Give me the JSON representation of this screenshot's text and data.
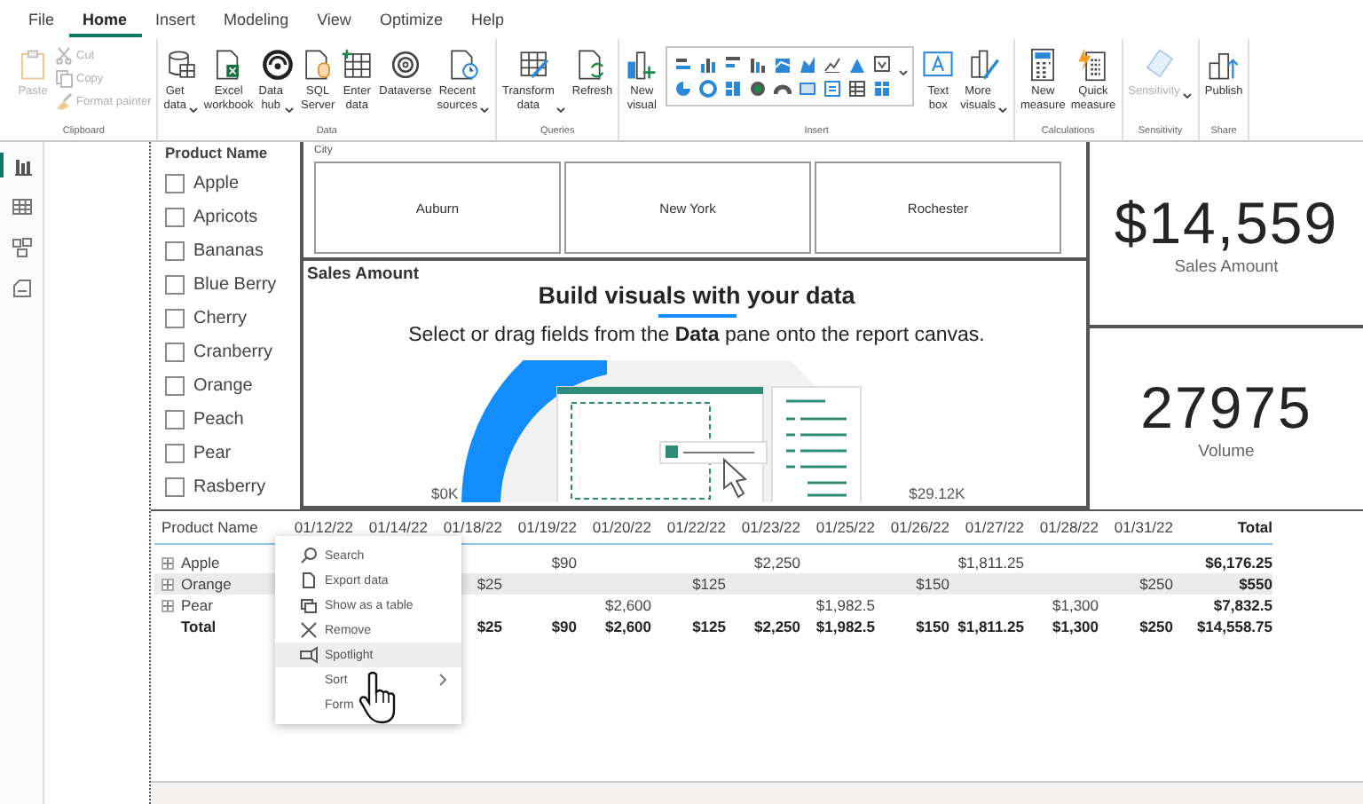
{
  "ribbon": {
    "tabs": [
      {
        "label": "File",
        "selected": false
      },
      {
        "label": "Home",
        "selected": true
      },
      {
        "label": "Insert",
        "selected": false
      },
      {
        "label": "Modeling",
        "selected": false
      },
      {
        "label": "View",
        "selected": false
      },
      {
        "label": "Optimize",
        "selected": false
      },
      {
        "label": "Help",
        "selected": false
      }
    ],
    "groups": [
      {
        "label": "Clipboard",
        "buttons": [
          {
            "kind": "large",
            "label": "Paste",
            "disabled": true,
            "dropdown": false
          },
          {
            "kind": "small",
            "label": "Cut",
            "disabled": true,
            "dropdown": false
          },
          {
            "kind": "small",
            "label": "Copy",
            "disabled": true,
            "dropdown": false
          },
          {
            "kind": "small",
            "label": "Format painter",
            "disabled": true,
            "dropdown": false
          }
        ]
      },
      {
        "label": "Data",
        "buttons": [
          {
            "kind": "large",
            "label": "Get data",
            "disabled": false,
            "dropdown": true
          },
          {
            "kind": "large",
            "label": "Excel workbook",
            "disabled": false,
            "dropdown": false
          },
          {
            "kind": "large",
            "label": "Data hub",
            "disabled": false,
            "dropdown": true
          },
          {
            "kind": "large",
            "label": "SQL Server",
            "disabled": false,
            "dropdown": false
          },
          {
            "kind": "large",
            "label": "Enter data",
            "disabled": false,
            "dropdown": false
          },
          {
            "kind": "large",
            "label": "Dataverse",
            "disabled": false,
            "dropdown": false
          },
          {
            "kind": "large",
            "label": "Recent sources",
            "disabled": false,
            "dropdown": true
          }
        ]
      },
      {
        "label": "Queries",
        "buttons": [
          {
            "kind": "large",
            "label": "Transform data",
            "disabled": false,
            "dropdown": true
          },
          {
            "kind": "large",
            "label": "Refresh",
            "disabled": false,
            "dropdown": false
          }
        ]
      },
      {
        "label": "Insert",
        "buttons": [
          {
            "kind": "large",
            "label": "New visual",
            "disabled": false,
            "dropdown": false
          },
          {
            "kind": "gallery"
          },
          {
            "kind": "large",
            "label": "Text box",
            "disabled": false,
            "dropdown": false
          },
          {
            "kind": "large",
            "label": "More visuals",
            "disabled": false,
            "dropdown": true
          }
        ]
      },
      {
        "label": "Calculations",
        "buttons": [
          {
            "kind": "large",
            "label": "New measure",
            "disabled": false,
            "dropdown": false
          },
          {
            "kind": "large",
            "label": "Quick measure",
            "disabled": false,
            "dropdown": false
          }
        ]
      },
      {
        "label": "Sensitivity",
        "buttons": [
          {
            "kind": "large",
            "label": "Sensitivity",
            "disabled": true,
            "dropdown": true
          }
        ]
      },
      {
        "label": "Share",
        "buttons": [
          {
            "kind": "large",
            "label": "Publish",
            "disabled": false,
            "dropdown": false
          }
        ]
      }
    ]
  },
  "nav": [
    {
      "selected": true
    },
    {
      "selected": false
    },
    {
      "selected": false
    },
    {
      "selected": false
    }
  ],
  "slicer": {
    "title": "Product Name",
    "items": [
      {
        "label": "Apple",
        "checked": false
      },
      {
        "label": "Apricots",
        "checked": false
      },
      {
        "label": "Bananas",
        "checked": false
      },
      {
        "label": "Blue Berry",
        "checked": false
      },
      {
        "label": "Cherry",
        "checked": false
      },
      {
        "label": "Cranberry",
        "checked": false
      },
      {
        "label": "Orange",
        "checked": false
      },
      {
        "label": "Peach",
        "checked": false
      },
      {
        "label": "Pear",
        "checked": false
      },
      {
        "label": "Rasberry",
        "checked": false
      }
    ]
  },
  "city_slicer": {
    "title": "City",
    "tiles": [
      {
        "label": "Auburn",
        "selected": false
      },
      {
        "label": "New York",
        "selected": false
      },
      {
        "label": "Rochester",
        "selected": false
      }
    ]
  },
  "sales_visual": {
    "title": "Sales Amount",
    "heading": "Build visuals with your data",
    "message": "Select or drag fields from the **Data** pane onto the report canvas.",
    "axis_min": "$0K",
    "axis_max": "$29.12K"
  },
  "cards": [
    {
      "value": "$14,559",
      "label": "Sales Amount"
    },
    {
      "value": "27975",
      "label": "Volume"
    }
  ],
  "matrix": {
    "columns": [
      "Product Name",
      "01/12/22",
      "01/14/22",
      "01/18/22",
      "01/19/22",
      "01/20/22",
      "01/22/22",
      "01/23/22",
      "01/25/22",
      "01/26/22",
      "01/27/22",
      "01/28/22",
      "01/31/22",
      "Total"
    ],
    "rows": [
      {
        "kind": "item",
        "expanded": false,
        "highlighted": false,
        "cells": [
          "Apple",
          null,
          null,
          null,
          "$90",
          null,
          null,
          "$2,250",
          null,
          null,
          "$1,811.25",
          null,
          null,
          "$6,176.25"
        ]
      },
      {
        "kind": "item",
        "expanded": false,
        "highlighted": true,
        "cells": [
          "Orange",
          null,
          null,
          "$25",
          null,
          null,
          "$125",
          null,
          null,
          "$150",
          null,
          null,
          "$250",
          "$550"
        ]
      },
      {
        "kind": "item",
        "expanded": false,
        "highlighted": false,
        "cells": [
          "Pear",
          null,
          null,
          null,
          null,
          "$2,600",
          null,
          null,
          "$1,982.5",
          null,
          null,
          "$1,300",
          null,
          "$7,832.5"
        ]
      },
      {
        "kind": "total",
        "highlighted": false,
        "cells": [
          "Total",
          null,
          null,
          "$25",
          "$90",
          "$2,600",
          "$125",
          "$2,250",
          "$1,982.5",
          "$150",
          "$1,811.25",
          "$1,300",
          "$250",
          "$14,558.75"
        ]
      }
    ]
  },
  "context_menu": {
    "items": [
      {
        "label": "Search",
        "hovered": false,
        "submenu": false
      },
      {
        "label": "Export data",
        "hovered": false,
        "submenu": false
      },
      {
        "label": "Show as a table",
        "hovered": false,
        "submenu": false
      },
      {
        "label": "Remove",
        "hovered": false,
        "submenu": false
      },
      {
        "label": "Spotlight",
        "hovered": true,
        "submenu": false
      },
      {
        "label": "Sort",
        "hovered": false,
        "submenu": true
      },
      {
        "label": "Form",
        "hovered": false,
        "submenu": false
      }
    ]
  }
}
